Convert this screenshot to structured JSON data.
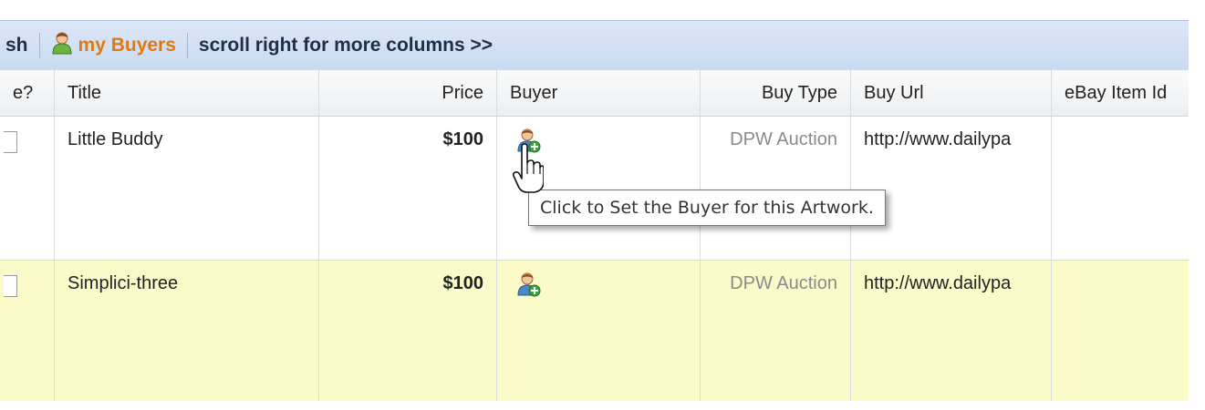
{
  "toolbar": {
    "fresh_label": "sh",
    "buyers_label": "my Buyers",
    "scroll_hint": "scroll right for more columns >>"
  },
  "columns": [
    "e?",
    "Title",
    "Price",
    "Buyer",
    "Buy Type",
    "Buy Url",
    "eBay Item Id"
  ],
  "rows": [
    {
      "title": "Little Buddy",
      "price": "$100",
      "buy_type": "DPW Auction",
      "buy_url": "http://www.dailypa",
      "ebay_item_id": ""
    },
    {
      "title": "Simplici-three",
      "price": "$100",
      "buy_type": "DPW Auction",
      "buy_url": "http://www.dailypa",
      "ebay_item_id": ""
    }
  ],
  "tooltip": {
    "text": "Click to Set the Buyer for this Artwork."
  },
  "icons": {
    "buyers": "user-icon",
    "set_buyer": "add-user-icon",
    "cursor": "hand-pointer-icon"
  },
  "colors": {
    "toolbar_bg": "#c9daf1",
    "buyers_link": "#e07a10",
    "highlight_row": "#fbfbc9",
    "muted_text": "#8a8a8a"
  }
}
